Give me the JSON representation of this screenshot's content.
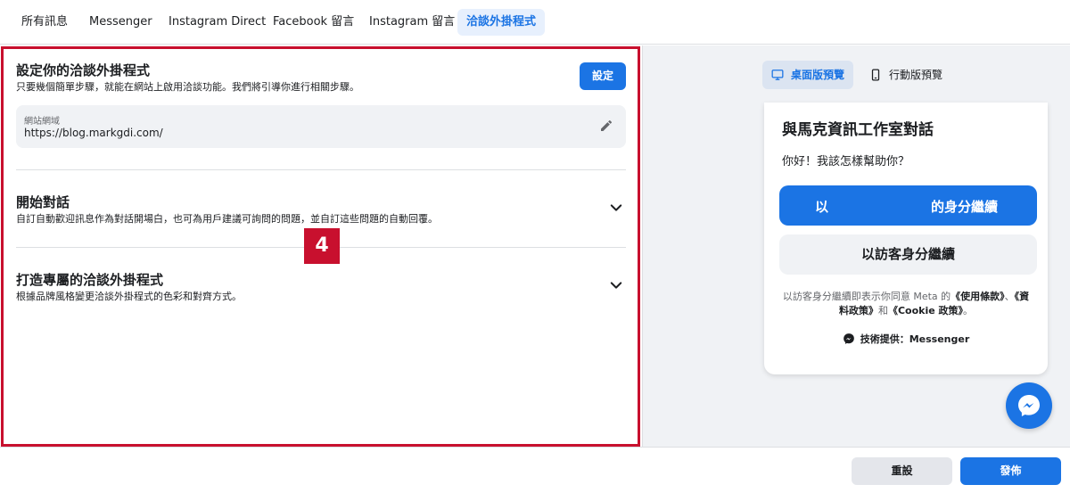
{
  "tabs": [
    {
      "label": "所有訊息"
    },
    {
      "label": "Messenger"
    },
    {
      "label": "Instagram Direct"
    },
    {
      "label": "Facebook 留言"
    },
    {
      "label": "Instagram 留言"
    },
    {
      "label": "洽談外掛程式",
      "active": true
    }
  ],
  "setup": {
    "title": "設定你的洽談外掛程式",
    "description": "只要幾個簡單步驟，就能在網站上啟用洽談功能。我們將引導你進行相關步驟。",
    "button_label": "設定",
    "domain_label": "網站網域",
    "domain_value": "https://blog.markgdi.com/"
  },
  "start_chat": {
    "title": "開始對話",
    "description": "自訂自動歡迎訊息作為對話開場白，也可為用戶建議可詢問的問題，並自訂這些問題的自動回覆。"
  },
  "customize": {
    "title": "打造專屬的洽談外掛程式",
    "description": "根據品牌風格變更洽談外掛程式的色彩和對齊方式。"
  },
  "annotation_badge": "4",
  "preview": {
    "desktop_label": "桌面版預覽",
    "mobile_label": "行動版預覽",
    "card_title": "與馬克資訊工作室對話",
    "greeting": "你好！我該怎樣幫助你？",
    "continue_part1": "以",
    "continue_part2": "的身分繼續",
    "guest_button": "以訪客身分繼續",
    "terms_prefix": "以訪客身分繼續即表示你同意 Meta 的",
    "terms_link1": "《使用條款》",
    "terms_sep": "、",
    "terms_link2": "《資料政策》",
    "terms_and": "和",
    "terms_link3": "《Cookie 政策》",
    "terms_end": "。",
    "powered_by": "技術提供：Messenger"
  },
  "footer": {
    "reset_label": "重設",
    "publish_label": "發佈"
  },
  "colors": {
    "accent": "#1b74e4",
    "highlight_box": "#c8102e"
  },
  "icons": [
    "pencil-icon",
    "chevron-down-icon",
    "desktop-icon",
    "mobile-icon",
    "messenger-icon"
  ]
}
